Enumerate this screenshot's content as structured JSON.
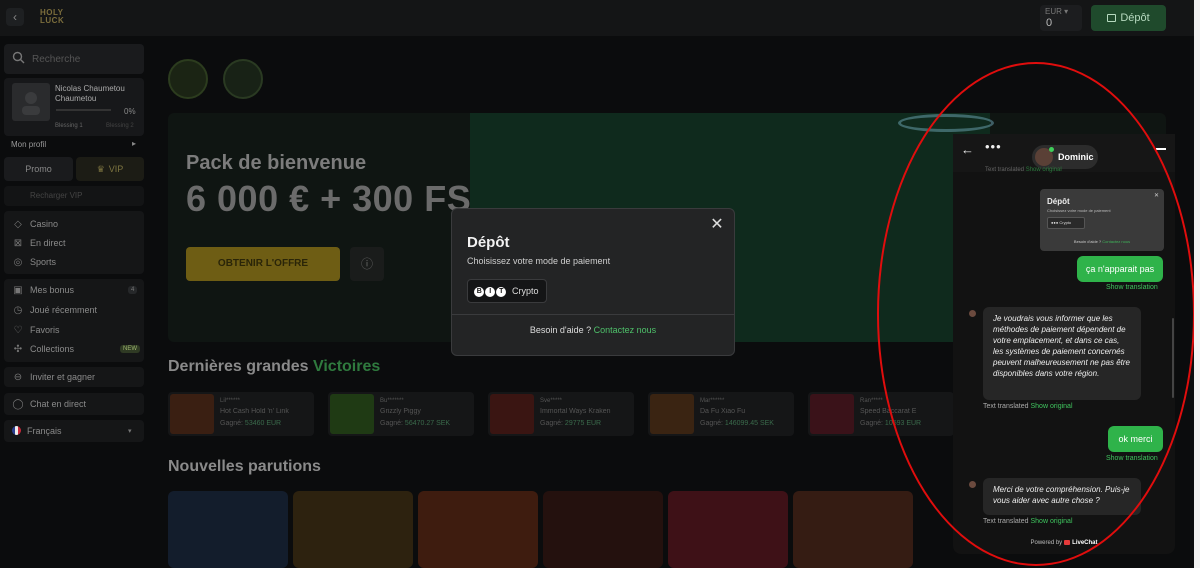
{
  "topbar": {
    "back_icon": "‹",
    "logo_line1": "HOLY",
    "logo_line2": "LUCK",
    "balance_currency": "EUR ▾",
    "balance_amount": "0",
    "deposit_label": "Dépôt",
    "deposit_icon": "wallet-icon"
  },
  "sidebar": {
    "search_placeholder": "Recherche",
    "user_name": "Nicolas Chaumetou Chaumetou",
    "level_pct": "0%",
    "level_from": "Blessing 1",
    "level_to": "Blessing 2",
    "profile_link": "Mon profil",
    "promo_label": "Promo",
    "vip_label": "VIP",
    "recharge_label": "Recharger VIP",
    "menu1": [
      {
        "label": "Casino",
        "icon": "◇"
      },
      {
        "label": "En direct",
        "icon": "⊠"
      },
      {
        "label": "Sports",
        "icon": "◎"
      }
    ],
    "menu2": [
      {
        "label": "Mes bonus",
        "icon": "▣",
        "count": "4"
      },
      {
        "label": "Joué récemment",
        "icon": "◷"
      },
      {
        "label": "Favoris",
        "icon": "♡"
      },
      {
        "label": "Collections",
        "icon": "✣",
        "badge": "NEW"
      }
    ],
    "invite_label": "Inviter et gagner",
    "chat_label": "Chat en direct",
    "lang_label": "Français",
    "lang_arrow": "▾"
  },
  "main": {
    "banner_title": "Pack de bienvenue",
    "banner_amount": "6 000 € + 300 FS",
    "offer_button": "OBTENIR L'OFFRE",
    "info_icon": "ⓘ",
    "wins_title": "Dernières grandes",
    "wins_title_accent": "Victoires",
    "wins": [
      {
        "user": "Lil******",
        "game": "Hot Cash Hold 'n' Link",
        "won_label": "Gagné:",
        "amount": "53460 EUR",
        "color": "#3a1f12"
      },
      {
        "user": "Bu*******",
        "game": "Grizzly Piggy",
        "won_label": "Gagné:",
        "amount": "56470.27 SEK",
        "color": "#1f3a14"
      },
      {
        "user": "Sve*****",
        "game": "Immortal Ways Kraken",
        "won_label": "Gagné:",
        "amount": "29775 EUR",
        "color": "#3a1512"
      },
      {
        "user": "Mar******",
        "game": "Da Fu Xiao Fu",
        "won_label": "Gagné:",
        "amount": "146099.45 SEK",
        "color": "#3a2412"
      },
      {
        "user": "Ran*****",
        "game": "Speed Baccarat E",
        "won_label": "Gagné:",
        "amount": "10593 EUR",
        "color": "#3a1219"
      }
    ],
    "releases_title": "Nouvelles parutions",
    "releases": [
      {
        "color": "#1c2b47"
      },
      {
        "color": "#4a3412"
      },
      {
        "color": "#6a2a12"
      },
      {
        "color": "#3a1510"
      },
      {
        "color": "#6a1520"
      },
      {
        "color": "#5a2a1a"
      }
    ]
  },
  "modal": {
    "title": "Dépôt",
    "subtitle": "Choisissez votre mode de paiement",
    "method_logo": "BIT",
    "method_label": "Crypto",
    "help_text": "Besoin d'aide ?",
    "help_link": "Contactez nous",
    "close_icon": "✕"
  },
  "chat": {
    "back_icon": "←",
    "menu_icon": "•••",
    "agent_name": "Dominic",
    "cut_text": "Text translated",
    "cut_link": "Show original",
    "shot_title": "Dépôt",
    "shot_sub": "Choisissez votre mode de paiement",
    "shot_pay": "Crypto",
    "shot_help": "Besoin d'aide ?",
    "shot_help_link": "Contactez nous",
    "msg1": "ça n'apparait pas",
    "show_translation": "Show translation",
    "msg2": "Je voudrais vous informer que les méthodes de paiement dépendent de votre emplacement, et dans ce cas, les systèmes de paiement concernés peuvent malheureusement ne pas être disponibles dans votre région.",
    "text_translated": "Text translated",
    "show_original": "Show original",
    "msg3": "ok merci",
    "msg4": "Merci de votre compréhension. Puis-je vous aider avec autre chose ?",
    "powered_by": "Powered by",
    "powered_brand": "LiveChat"
  },
  "colors": {
    "accent_green": "#2fb34a",
    "annotation_red": "#e00d0d",
    "gold": "#6e5d14"
  }
}
